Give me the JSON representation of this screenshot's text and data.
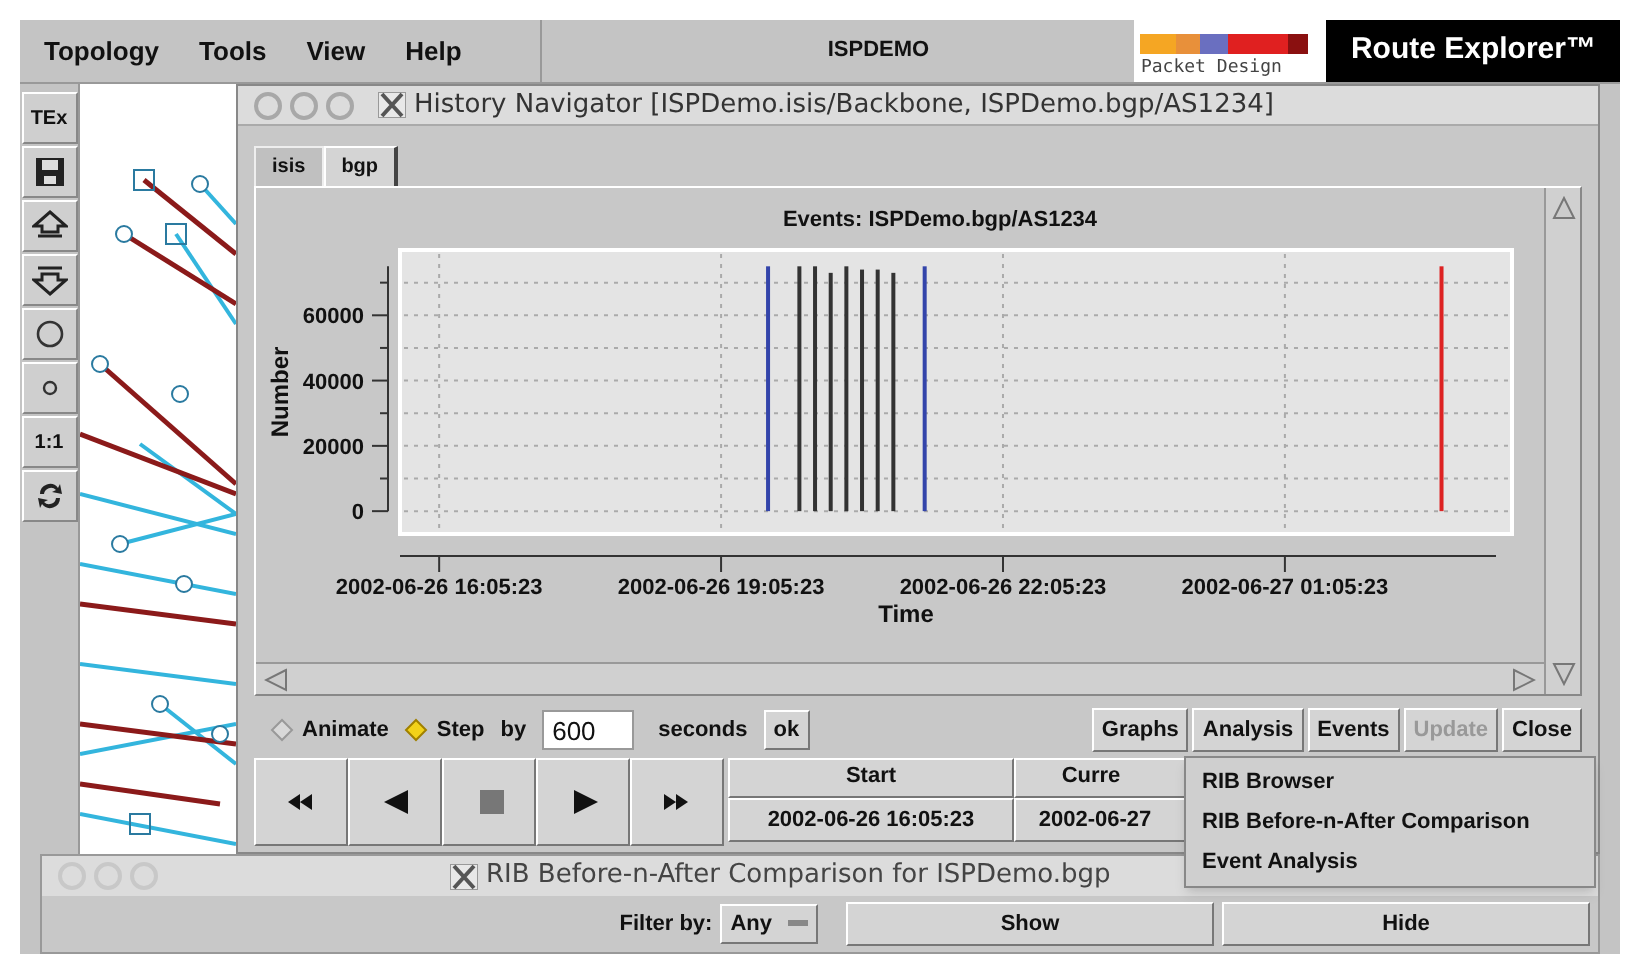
{
  "app": {
    "menu": [
      {
        "label": "Topology"
      },
      {
        "label": "Tools"
      },
      {
        "label": "View"
      },
      {
        "label": "Help"
      }
    ],
    "title": "ISPDEMO",
    "logo": {
      "company": "Packet Design",
      "product": "Route Explorer™"
    },
    "toolbar": [
      {
        "kind": "text",
        "label": "TEx"
      },
      {
        "kind": "save"
      },
      {
        "kind": "up"
      },
      {
        "kind": "down"
      },
      {
        "kind": "big-circle"
      },
      {
        "kind": "small-circle"
      },
      {
        "kind": "text",
        "label": "1:1"
      },
      {
        "kind": "refresh"
      }
    ]
  },
  "history_navigator": {
    "title": "History Navigator [ISPDemo.isis/Backbone, ISPDemo.bgp/AS1234]",
    "tabs": [
      {
        "label": "isis",
        "selected": false
      },
      {
        "label": "bgp",
        "selected": true
      }
    ],
    "chart_title": "Events: ISPDemo.bgp/AS1234",
    "chart_data": {
      "type": "bar",
      "xlabel": "Time",
      "ylabel": "Number",
      "categories": [
        null,
        null,
        "2002-06-26 16:05:23",
        null,
        null,
        null,
        null,
        null,
        null,
        null,
        null,
        null,
        null,
        null,
        null,
        null,
        null,
        null,
        null,
        null,
        "2002-06-26 19:05:23",
        null,
        null,
        null,
        null,
        null,
        null,
        null,
        null,
        null,
        null,
        null,
        null,
        null,
        null,
        null,
        null,
        null,
        "2002-06-26 22:05:23",
        null,
        null,
        null,
        null,
        null,
        null,
        null,
        null,
        null,
        null,
        null,
        null,
        null,
        null,
        null,
        null,
        null,
        "2002-06-27 01:05:23",
        null,
        null,
        null,
        null,
        null,
        null,
        null,
        null,
        null,
        null,
        null,
        null,
        null,
        null
      ],
      "series": [
        {
          "color": "#333333",
          "values": [
            null,
            null,
            null,
            null,
            null,
            null,
            null,
            null,
            null,
            null,
            null,
            null,
            null,
            null,
            null,
            null,
            null,
            null,
            null,
            null,
            null,
            null,
            null,
            null,
            null,
            75000,
            75000,
            73000,
            75000,
            74000,
            74000,
            73000,
            null,
            null,
            null,
            null,
            null,
            null,
            null,
            null,
            null,
            null,
            null,
            null,
            null,
            null,
            null,
            null,
            null,
            null,
            null,
            null,
            null,
            null,
            null,
            null,
            null,
            null,
            null,
            null,
            null,
            null,
            null,
            null,
            null,
            null,
            null,
            null,
            null,
            null,
            null
          ]
        },
        {
          "color": "#3344aa",
          "values": [
            null,
            null,
            null,
            null,
            null,
            null,
            null,
            null,
            null,
            null,
            null,
            null,
            null,
            null,
            null,
            null,
            null,
            null,
            null,
            null,
            null,
            null,
            null,
            75000,
            null,
            null,
            null,
            null,
            null,
            null,
            null,
            null,
            null,
            75000,
            null,
            null,
            null,
            null,
            null,
            null,
            null,
            null,
            null,
            null,
            null,
            null,
            null,
            null,
            null,
            null,
            null,
            null,
            null,
            null,
            null,
            null,
            null,
            null,
            null,
            null,
            null,
            null,
            null,
            null,
            null,
            null,
            null,
            null,
            null,
            null,
            null
          ]
        },
        {
          "color": "#dd2222",
          "values": [
            null,
            null,
            null,
            null,
            null,
            null,
            null,
            null,
            null,
            null,
            null,
            null,
            null,
            null,
            null,
            null,
            null,
            null,
            null,
            null,
            null,
            null,
            null,
            null,
            null,
            null,
            null,
            null,
            null,
            null,
            null,
            null,
            null,
            null,
            null,
            null,
            null,
            null,
            null,
            null,
            null,
            null,
            null,
            null,
            null,
            null,
            null,
            null,
            null,
            null,
            null,
            null,
            null,
            null,
            null,
            null,
            null,
            null,
            null,
            null,
            null,
            null,
            null,
            null,
            null,
            null,
            75000,
            null,
            null,
            null,
            null
          ]
        }
      ],
      "ylim": [
        -7000,
        80000
      ],
      "grid": true,
      "yticks": [
        0,
        20000,
        40000,
        60000
      ]
    },
    "modes": [
      {
        "label": "Animate",
        "selected": false
      },
      {
        "label": "Step",
        "selected": true
      }
    ],
    "step_by": "by",
    "step_value": "600",
    "step_unit": "seconds",
    "ok": "ok",
    "buttons": [
      {
        "label": "Graphs",
        "disabled": false
      },
      {
        "label": "Analysis",
        "disabled": false
      },
      {
        "label": "Events",
        "disabled": false
      },
      {
        "label": "Update",
        "disabled": true
      },
      {
        "label": "Close",
        "disabled": false
      }
    ],
    "transport": [
      {
        "kind": "rewind"
      },
      {
        "kind": "back"
      },
      {
        "kind": "stop"
      },
      {
        "kind": "play"
      },
      {
        "kind": "forward"
      }
    ],
    "times": [
      {
        "header": "Start",
        "value": "2002-06-26 16:05:23"
      },
      {
        "header": "Curre",
        "value": "2002-06-27"
      }
    ]
  },
  "analysis_menu": [
    {
      "label": "RIB Browser"
    },
    {
      "label": "RIB Before-n-After Comparison"
    },
    {
      "label": "Event Analysis"
    }
  ],
  "rib_window": {
    "title": "RIB Before-n-After Comparison for ISPDemo.bgp",
    "filter_label": "Filter by:",
    "filter_value": "Any",
    "buttons": [
      "Show",
      "Hide"
    ]
  }
}
